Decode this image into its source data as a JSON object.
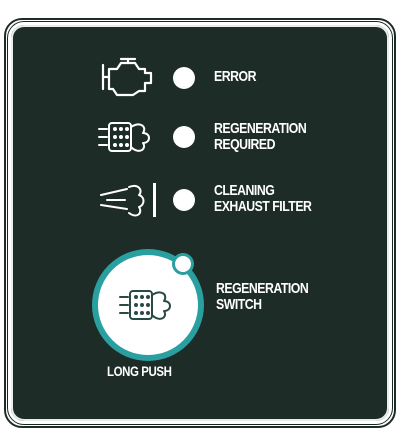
{
  "indicators": [
    {
      "line1": "ERROR",
      "line2": "",
      "icon": "engine-check-icon"
    },
    {
      "line1": "REGENERATION",
      "line2": "REQUIRED",
      "icon": "dpf-regeneration-icon"
    },
    {
      "line1": "CLEANING",
      "line2": "EXHAUST FILTER",
      "icon": "exhaust-cleaning-icon"
    }
  ],
  "switch": {
    "line1": "REGENERATION",
    "line2": "SWITCH",
    "hint": "LONG PUSH",
    "icon": "dpf-regeneration-icon"
  },
  "colors": {
    "panel": "#1e2c28",
    "accent": "#2a9fa0",
    "led": "#ffffff"
  }
}
